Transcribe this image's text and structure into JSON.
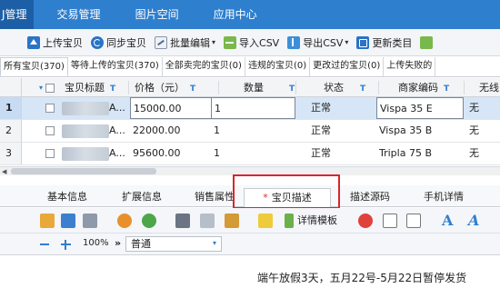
{
  "colors": {
    "nav_bg": "#2f7fcf",
    "nav_active": "#1d5fa6",
    "selected_row": "#d6e6f7",
    "highlight_box": "#d9262b"
  },
  "topnav": {
    "items": [
      {
        "label": "J管理",
        "active": true
      },
      {
        "label": "交易管理",
        "active": false
      },
      {
        "label": "图片空间",
        "active": false
      },
      {
        "label": "应用中心",
        "active": false
      }
    ]
  },
  "toolbar": {
    "upload": "上传宝贝",
    "sync": "同步宝贝",
    "batch_edit": "批量编辑",
    "import_csv": "导入CSV",
    "export_csv": "导出CSV",
    "update_category": "更新类目"
  },
  "product_tabs": [
    "所有宝贝(370)",
    "等待上传的宝贝(370)",
    "全部卖完的宝贝(0)",
    "违规的宝贝(0)",
    "更改过的宝贝(0)",
    "上传失败的"
  ],
  "grid": {
    "columns": [
      "宝贝标题",
      "价格（元）",
      "数量",
      "状态",
      "商家编码",
      "无线"
    ],
    "rows": [
      {
        "num": "1",
        "title": "A...",
        "price": "15000.00",
        "qty": "1",
        "status": "正常",
        "code": "Vispa 35 E",
        "wireless": "无",
        "selected": true
      },
      {
        "num": "2",
        "title": "A...",
        "price": "22000.00",
        "qty": "1",
        "status": "正常",
        "code": "Vispa 35 B",
        "wireless": "无",
        "selected": false
      },
      {
        "num": "3",
        "title": "A...",
        "price": "95600.00",
        "qty": "1",
        "status": "正常",
        "code": "Tripla 75 B",
        "wireless": "无",
        "selected": false
      }
    ]
  },
  "detail_tabs": {
    "basic": "基本信息",
    "extended": "扩展信息",
    "sales_attr": "销售属性",
    "description_star": "*",
    "description": "宝贝描述",
    "source": "描述源码",
    "mobile": "手机详情"
  },
  "editor_toolbar": {
    "template_label": "详情模板"
  },
  "zoom": {
    "level": "100%",
    "arrow": "»",
    "format": "普通"
  },
  "editor": {
    "content": "端午放假3天，五月22号-5月22日暂停发货"
  }
}
